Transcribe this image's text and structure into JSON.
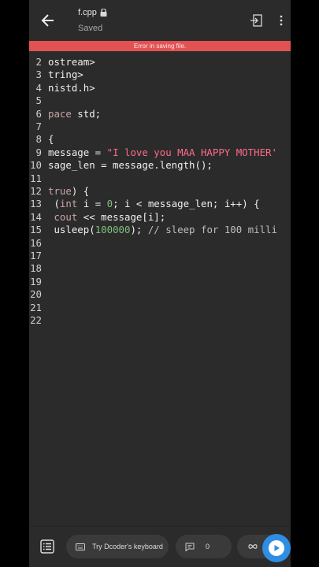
{
  "header": {
    "filename": "f.cpp",
    "status": "Saved"
  },
  "error_banner": "Error in saving file.",
  "editor": {
    "lines": [
      {
        "n": "2",
        "parts": [
          {
            "t": "ostream>",
            "c": ""
          }
        ]
      },
      {
        "n": "3",
        "parts": [
          {
            "t": "tring>",
            "c": ""
          }
        ]
      },
      {
        "n": "4",
        "parts": [
          {
            "t": "nistd.h>",
            "c": ""
          }
        ]
      },
      {
        "n": "5",
        "parts": []
      },
      {
        "n": "6",
        "parts": [
          {
            "t": "pace",
            "c": "kw"
          },
          {
            "t": " std;",
            "c": ""
          }
        ]
      },
      {
        "n": "7",
        "parts": []
      },
      {
        "n": "8",
        "parts": [
          {
            "t": "{",
            "c": ""
          }
        ]
      },
      {
        "n": "9",
        "parts": [
          {
            "t": "message = ",
            "c": ""
          },
          {
            "t": "\"I love you MAA HAPPY MOTHER'",
            "c": "str"
          }
        ]
      },
      {
        "n": "10",
        "parts": [
          {
            "t": "sage_len = message.length();",
            "c": ""
          }
        ]
      },
      {
        "n": "11",
        "parts": []
      },
      {
        "n": "12",
        "parts": [
          {
            "t": "true",
            "c": "kw"
          },
          {
            "t": ") {",
            "c": ""
          }
        ]
      },
      {
        "n": "13",
        "parts": [
          {
            "t": " (",
            "c": ""
          },
          {
            "t": "int",
            "c": "kw"
          },
          {
            "t": " i = ",
            "c": ""
          },
          {
            "t": "0",
            "c": "num"
          },
          {
            "t": "; i < message_len; i++) {",
            "c": ""
          }
        ]
      },
      {
        "n": "14",
        "parts": [
          {
            "t": " ",
            "c": ""
          },
          {
            "t": "cout",
            "c": "kw"
          },
          {
            "t": " << message[i];",
            "c": ""
          }
        ]
      },
      {
        "n": "15",
        "parts": [
          {
            "t": " usleep(",
            "c": ""
          },
          {
            "t": "100000",
            "c": "num"
          },
          {
            "t": "); ",
            "c": ""
          },
          {
            "t": "// sleep for 100 milli",
            "c": "cm"
          }
        ]
      },
      {
        "n": "16",
        "parts": []
      },
      {
        "n": "17",
        "parts": []
      },
      {
        "n": "18",
        "parts": []
      },
      {
        "n": "19",
        "parts": []
      },
      {
        "n": "20",
        "parts": []
      },
      {
        "n": "21",
        "parts": []
      },
      {
        "n": "22",
        "parts": []
      }
    ]
  },
  "bottom_bar": {
    "keyboard_label": "Try Dcoder's keyboard",
    "comment_count": "0"
  },
  "icons": [
    "back-arrow-icon",
    "lock-icon",
    "exit-icon",
    "more-vertical-icon",
    "list-icon",
    "keyboard-icon",
    "comment-icon",
    "infinity-icon",
    "play-icon"
  ],
  "colors": {
    "error": "#e35252",
    "accent": "#2f8de3",
    "string": "#ff6b8a",
    "number": "#7fbf7f"
  }
}
